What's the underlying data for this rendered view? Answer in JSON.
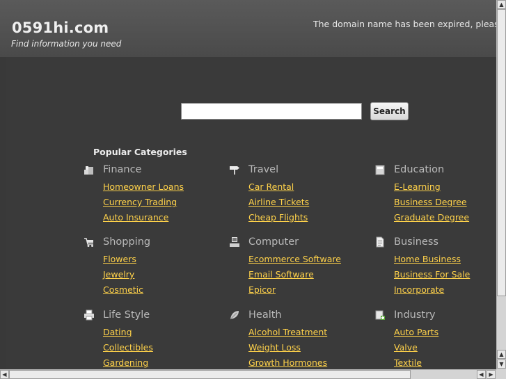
{
  "header": {
    "site_title": "0591hi.com",
    "tagline": "Find information you need",
    "notice": "The domain name has been expired, please re"
  },
  "search": {
    "placeholder": "",
    "button_label": "Search"
  },
  "popular": {
    "title": "Popular Categories",
    "categories": [
      {
        "title": "Finance",
        "icon": "finance-icon",
        "links": [
          "Homeowner Loans",
          "Currency Trading",
          "Auto Insurance"
        ]
      },
      {
        "title": "Travel",
        "icon": "signpost-icon",
        "links": [
          "Car Rental",
          "Airline Tickets",
          "Cheap Flights"
        ]
      },
      {
        "title": "Education",
        "icon": "book-icon",
        "links": [
          "E-Learning",
          "Business Degree",
          "Graduate Degree"
        ]
      },
      {
        "title": "Shopping",
        "icon": "cart-icon",
        "links": [
          "Flowers",
          "Jewelry",
          "Cosmetic"
        ]
      },
      {
        "title": "Computer",
        "icon": "computer-icon",
        "links": [
          "Ecommerce Software",
          "Email Software",
          "Epicor"
        ]
      },
      {
        "title": "Business",
        "icon": "document-icon",
        "links": [
          "Home Business",
          "Business For Sale",
          "Incorporate"
        ]
      },
      {
        "title": "Life Style",
        "icon": "printer-icon",
        "links": [
          "Dating",
          "Collectibles",
          "Gardening"
        ]
      },
      {
        "title": "Health",
        "icon": "leaf-icon",
        "links": [
          "Alcohol Treatment",
          "Weight Loss",
          "Growth Hormones"
        ]
      },
      {
        "title": "Industry",
        "icon": "industry-icon",
        "links": [
          "Auto Parts",
          "Valve",
          "Textile"
        ]
      }
    ]
  },
  "colors": {
    "link": "#ffd24a",
    "category_title": "#b9b9b9",
    "background": "#3a3a3a"
  }
}
